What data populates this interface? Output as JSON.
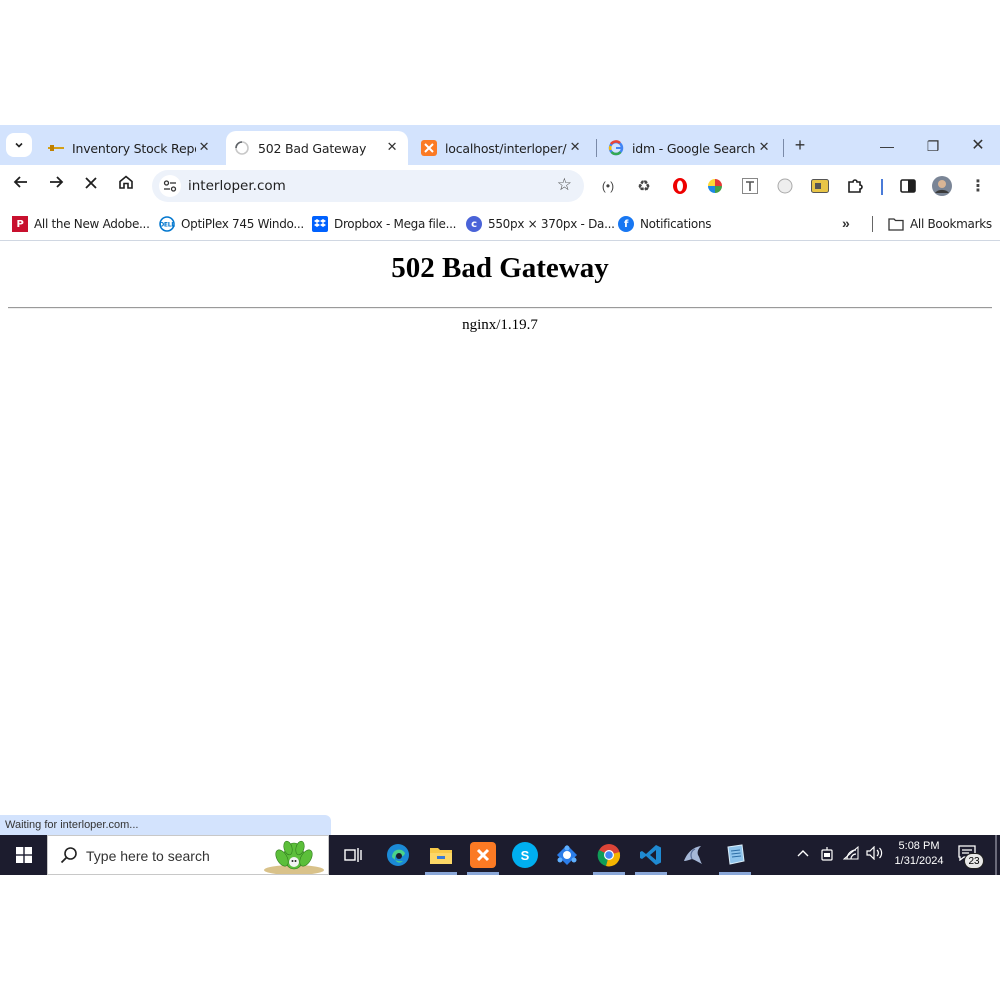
{
  "browser": {
    "tabs": [
      {
        "title": "Inventory Stock Report",
        "icon": "inventory-favicon",
        "active": false
      },
      {
        "title": "502 Bad Gateway",
        "icon": "loading-spinner-icon",
        "active": true
      },
      {
        "title": "localhost/interloper/m",
        "icon": "xampp-favicon",
        "active": false
      },
      {
        "title": "idm - Google Search",
        "icon": "google-favicon",
        "active": false
      }
    ],
    "address": "interloper.com",
    "bookmarks": [
      {
        "label": "All the New Adobe...",
        "icon": "adobe-favicon",
        "color": "#c8102e"
      },
      {
        "label": "OptiPlex 745 Windo...",
        "icon": "dell-favicon",
        "color": "#0076ce"
      },
      {
        "label": "Dropbox - Mega file...",
        "icon": "dropbox-favicon",
        "color": "#0061fe"
      },
      {
        "label": "550px × 370px - Da...",
        "icon": "c-favicon",
        "color": "#4a63d8"
      },
      {
        "label": "Notifications",
        "icon": "facebook-favicon",
        "color": "#1877f2"
      }
    ],
    "all_bookmarks": "All Bookmarks",
    "status": "Waiting for interloper.com..."
  },
  "page": {
    "heading": "502 Bad Gateway",
    "server": "nginx/1.19.7"
  },
  "taskbar": {
    "search_placeholder": "Type here to search",
    "time": "5:08 PM",
    "date": "1/31/2024",
    "notifications": "23"
  },
  "colors": {
    "tabstrip": "#d3e3fd",
    "omnibox": "#edf2fa",
    "taskbar": "#1c1c2e"
  }
}
